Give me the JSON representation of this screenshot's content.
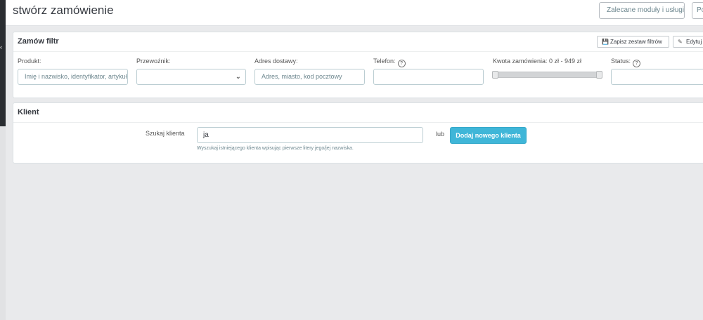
{
  "header": {
    "title": "stwórz zamówienie",
    "recommended_button": "Zalecane moduły i usługi",
    "extra_button": "Po"
  },
  "filter_panel": {
    "title": "Zamów filtr",
    "save_filters_button": "Zapisz zestaw filtrów",
    "edit_button": "Edytuj",
    "fields": {
      "product_label": "Produkt:",
      "product_placeholder": "Imię i nazwisko, identyfikator, artykuł",
      "carrier_label": "Przewoźnik:",
      "carrier_value": "",
      "address_label": "Adres dostawy:",
      "address_placeholder": "Adres, miasto, kod pocztowy",
      "phone_label": "Telefon:",
      "phone_value": "",
      "amount_label": "Kwota zamówienia: 0 zł - 949 zł",
      "status_label": "Status:",
      "status_value": ""
    },
    "help_glyph": "?"
  },
  "client_panel": {
    "title": "Klient",
    "search_label": "Szukaj klienta",
    "search_value": "ja",
    "or_text": "lub",
    "add_button": "Dodaj nowego klienta",
    "help_text": "Wyszukaj istniejącego klienta wpisując pierwsze litery jego/jej nazwiska."
  },
  "colors": {
    "accent": "#3fb6d8",
    "background": "#e9eaec",
    "text": "#363a41",
    "muted": "#6c868e"
  }
}
